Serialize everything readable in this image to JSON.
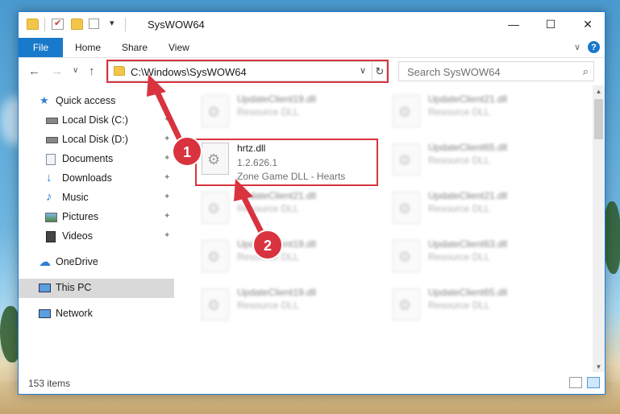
{
  "window": {
    "title": "SysWOW64",
    "minimize_glyph": "—",
    "maximize_glyph": "☐",
    "close_glyph": "✕"
  },
  "ribbon": {
    "file_tab": "File",
    "tabs": [
      "Home",
      "Share",
      "View"
    ],
    "collapse_glyph": "∨",
    "help_glyph": "?"
  },
  "navigation": {
    "back_glyph": "←",
    "forward_glyph": "→",
    "recent_glyph": "∨",
    "up_glyph": "↑",
    "address": "C:\\Windows\\SysWOW64",
    "address_dropdown_glyph": "∨",
    "refresh_glyph": "↻",
    "search_placeholder": "Search SysWOW64",
    "search_glyph": "⌕"
  },
  "sidebar": {
    "items": [
      {
        "label": "Quick access",
        "icon": "star-icon",
        "pinned": false
      },
      {
        "label": "Local Disk (C:)",
        "icon": "drive-icon",
        "pinned": true
      },
      {
        "label": "Local Disk (D:)",
        "icon": "drive-icon",
        "pinned": true
      },
      {
        "label": "Documents",
        "icon": "documents-icon",
        "pinned": true
      },
      {
        "label": "Downloads",
        "icon": "download-icon",
        "pinned": true
      },
      {
        "label": "Music",
        "icon": "music-icon",
        "pinned": true
      },
      {
        "label": "Pictures",
        "icon": "pictures-icon",
        "pinned": true
      },
      {
        "label": "Videos",
        "icon": "videos-icon",
        "pinned": true
      },
      {
        "label": "OneDrive",
        "icon": "cloud-icon",
        "pinned": false
      },
      {
        "label": "This PC",
        "icon": "computer-icon",
        "pinned": false,
        "selected": true
      },
      {
        "label": "Network",
        "icon": "network-icon",
        "pinned": false
      }
    ],
    "pin_glyph": "📌"
  },
  "files": {
    "focused": {
      "name": "hrtz.dll",
      "version": "1.2.626.1",
      "description": "Zone Game DLL - Hearts"
    },
    "background": [
      {
        "name": "UpdateClient19.dll",
        "type": "Resource DLL"
      },
      {
        "name": "UpdateClient21.dll",
        "type": "Resource DLL"
      },
      {
        "name": "UpdateClient65.dll",
        "type": "Resource DLL"
      },
      {
        "name": "UpdateClient21.dll",
        "type": "Resource DLL"
      },
      {
        "name": "UpdateClient21.dll",
        "type": "Resource DLL"
      },
      {
        "name": "UpdateClient19.dll",
        "type": "Resource DLL"
      },
      {
        "name": "UpdateClient63.dll",
        "type": "Resource DLL"
      },
      {
        "name": "UpdateClient19.dll",
        "type": "Resource DLL"
      },
      {
        "name": "UpdateClient65.dll",
        "type": "Resource DLL"
      }
    ]
  },
  "status": {
    "item_count": "153 items"
  },
  "annotations": {
    "step1": "1",
    "step2": "2",
    "color": "#d9333f"
  },
  "colors": {
    "accent": "#1979ca",
    "highlight": "#d9333f"
  }
}
